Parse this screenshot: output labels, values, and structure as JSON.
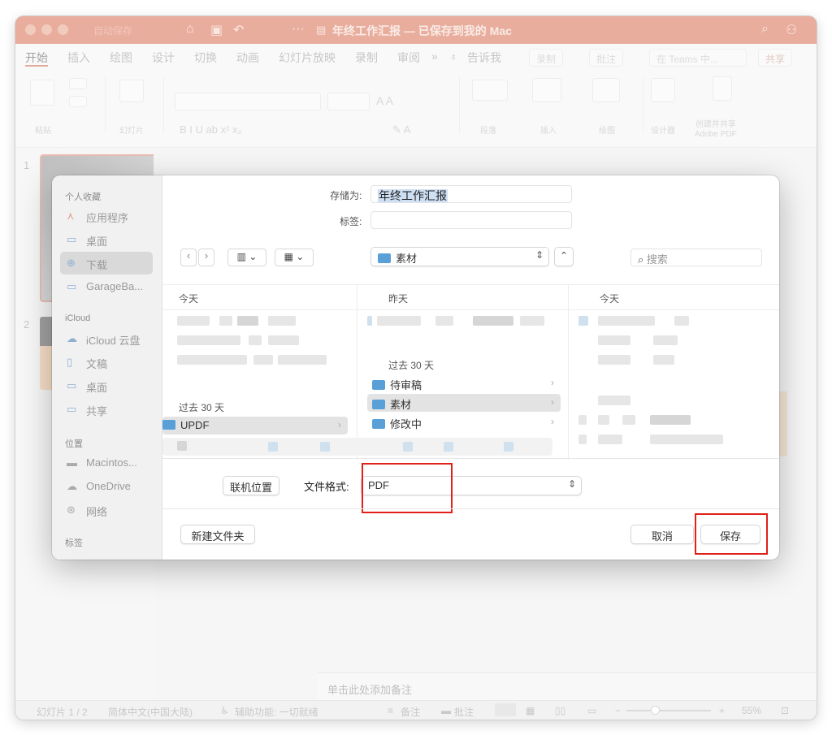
{
  "window": {
    "title": "年终工作汇报 — 已保存到我的 Mac",
    "titlebar_dim_text": "自动保存"
  },
  "ribbon": {
    "tabs": [
      "开始",
      "插入",
      "绘图",
      "设计",
      "切换",
      "动画",
      "幻灯片放映",
      "录制",
      "审阅"
    ],
    "tell_me": "告诉我",
    "record_label": "录制",
    "comments_label": "批注",
    "teams_label": "在 Teams 中...",
    "share_label": "共享",
    "groups": {
      "paste": "粘贴",
      "slides": "幻灯片",
      "paragraph": "段落",
      "insert": "插入",
      "drawing": "绘图",
      "designer": "设计器",
      "adobe": "创建并共享\nAdobe PDF"
    }
  },
  "slides": {
    "numbers": [
      "1",
      "2"
    ]
  },
  "notes": {
    "placeholder": "单击此处添加备注"
  },
  "status": {
    "slide_count": "幻灯片 1 / 2",
    "language": "简体中文(中国大陆)",
    "accessibility": "辅助功能: 一切就绪",
    "notes": "备注",
    "comments": "批注",
    "zoom": "55%"
  },
  "dialog": {
    "save_as_label": "存储为:",
    "save_as_value": "年终工作汇报",
    "tags_label": "标签:",
    "tags_value": "",
    "location": "素材",
    "search_placeholder": "搜索",
    "sidebar": {
      "favorites_head": "个人收藏",
      "favorites": [
        "应用程序",
        "桌面",
        "下载",
        "GarageBa..."
      ],
      "icloud_head": "iCloud",
      "icloud": [
        "iCloud 云盘",
        "文稿",
        "桌面",
        "共享"
      ],
      "locations_head": "位置",
      "locations": [
        "Macintos...",
        "OneDrive",
        "网络"
      ],
      "tags_head": "标签"
    },
    "columns": {
      "col1_head": "今天",
      "col1_sub": "过去 30 天",
      "col1_items": [
        "UPDF"
      ],
      "col2_head": "昨天",
      "col2_sub": "过去 30 天",
      "col2_items": [
        "待审稿",
        "素材",
        "修改中"
      ],
      "col3_head": "今天"
    },
    "online_locations_label": "联机位置",
    "format_label": "文件格式:",
    "format_value": "PDF",
    "new_folder_label": "新建文件夹",
    "cancel_label": "取消",
    "save_label": "保存"
  },
  "colors": {
    "titlebar": "#d86b4d",
    "highlight": "#e0201b",
    "folder": "#5aa0d8"
  }
}
